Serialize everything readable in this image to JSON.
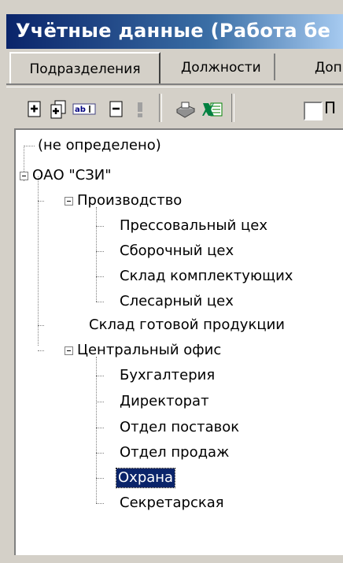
{
  "window": {
    "title": "Учётные данные (Работа бе"
  },
  "tabs": [
    {
      "label": "Подразделения",
      "active": true
    },
    {
      "label": "Должности",
      "active": false
    },
    {
      "label": "Доп",
      "active": false
    }
  ],
  "toolbar": {
    "checkbox_label": "П",
    "icons": [
      "add-item-icon",
      "add-subitem-icon",
      "rename-icon",
      "delete-icon",
      "info-icon",
      "print-icon",
      "excel-export-icon"
    ]
  },
  "tree": {
    "undefined_node": "(не определено)",
    "org": "ОАО \"СЗИ\"",
    "production": "Производство",
    "production_children": [
      "Прессовальный цех",
      "Сборочный цех",
      "Склад комплектующих",
      "Слесарный цех"
    ],
    "warehouse": "Склад готовой продукции",
    "central_office": "Центральный офис",
    "office_children": [
      "Бухгалтерия",
      "Директорат",
      "Отдел поставок",
      "Отдел продаж",
      "Охрана",
      "Секретарская"
    ],
    "selected": "Охрана"
  },
  "colors": {
    "selection": "#0a246a",
    "title_start": "#0a246a",
    "title_end": "#a6caf0"
  }
}
